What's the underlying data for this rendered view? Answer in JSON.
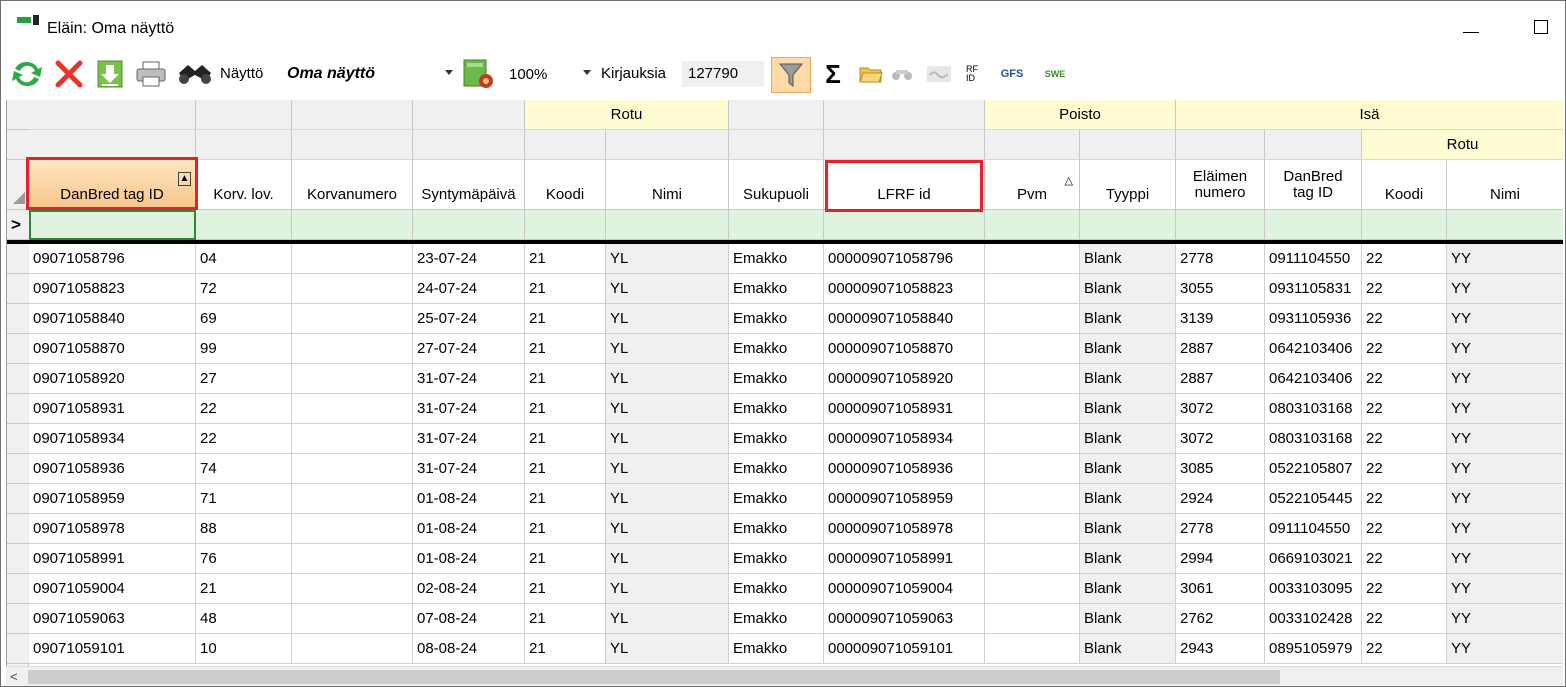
{
  "window": {
    "title": "Eläin: Oma näyttö"
  },
  "toolbar": {
    "icons": [
      "refresh-icon",
      "delete-icon",
      "download-icon",
      "print-icon",
      "binoculars-icon"
    ],
    "view_label": "Näyttö",
    "view_value": "Oma näyttö",
    "zoom_value": "100%",
    "records_label": "Kirjauksia",
    "records_count": "127790",
    "rfid_text": "RF\nID",
    "gfs_text": "GFS",
    "swe_text": "SWE"
  },
  "grid": {
    "group_headers": {
      "rotu": "Rotu",
      "poisto": "Poisto",
      "isa": "Isä",
      "isa_rotu": "Rotu"
    },
    "columns": [
      "DanBred tag ID",
      "Korv. lov.",
      "Korvanumero",
      "Syntymäpäivä",
      "Koodi",
      "Nimi",
      "Sukupuoli",
      "LFRF id",
      "Pvm",
      "Tyyppi",
      "Eläimen numero",
      "DanBred tag ID",
      "Koodi",
      "Nimi"
    ],
    "new_row_marker": ">",
    "rows": [
      [
        "09071058796",
        "04",
        "",
        "23-07-24",
        "21",
        "YL",
        "Emakko",
        "000009071058796",
        "",
        "Blank",
        "2778",
        "0911104550",
        "22",
        "YY"
      ],
      [
        "09071058823",
        "72",
        "",
        "24-07-24",
        "21",
        "YL",
        "Emakko",
        "000009071058823",
        "",
        "Blank",
        "3055",
        "0931105831",
        "22",
        "YY"
      ],
      [
        "09071058840",
        "69",
        "",
        "25-07-24",
        "21",
        "YL",
        "Emakko",
        "000009071058840",
        "",
        "Blank",
        "3139",
        "0931105936",
        "22",
        "YY"
      ],
      [
        "09071058870",
        "99",
        "",
        "27-07-24",
        "21",
        "YL",
        "Emakko",
        "000009071058870",
        "",
        "Blank",
        "2887",
        "0642103406",
        "22",
        "YY"
      ],
      [
        "09071058920",
        "27",
        "",
        "31-07-24",
        "21",
        "YL",
        "Emakko",
        "000009071058920",
        "",
        "Blank",
        "2887",
        "0642103406",
        "22",
        "YY"
      ],
      [
        "09071058931",
        "22",
        "",
        "31-07-24",
        "21",
        "YL",
        "Emakko",
        "000009071058931",
        "",
        "Blank",
        "3072",
        "0803103168",
        "22",
        "YY"
      ],
      [
        "09071058934",
        "22",
        "",
        "31-07-24",
        "21",
        "YL",
        "Emakko",
        "000009071058934",
        "",
        "Blank",
        "3072",
        "0803103168",
        "22",
        "YY"
      ],
      [
        "09071058936",
        "74",
        "",
        "31-07-24",
        "21",
        "YL",
        "Emakko",
        "000009071058936",
        "",
        "Blank",
        "3085",
        "0522105807",
        "22",
        "YY"
      ],
      [
        "09071058959",
        "71",
        "",
        "01-08-24",
        "21",
        "YL",
        "Emakko",
        "000009071058959",
        "",
        "Blank",
        "2924",
        "0522105445",
        "22",
        "YY"
      ],
      [
        "09071058978",
        "88",
        "",
        "01-08-24",
        "21",
        "YL",
        "Emakko",
        "000009071058978",
        "",
        "Blank",
        "2778",
        "0911104550",
        "22",
        "YY"
      ],
      [
        "09071058991",
        "76",
        "",
        "01-08-24",
        "21",
        "YL",
        "Emakko",
        "000009071058991",
        "",
        "Blank",
        "2994",
        "0669103021",
        "22",
        "YY"
      ],
      [
        "09071059004",
        "21",
        "",
        "02-08-24",
        "21",
        "YL",
        "Emakko",
        "000009071059004",
        "",
        "Blank",
        "3061",
        "0033103095",
        "22",
        "YY"
      ],
      [
        "09071059063",
        "48",
        "",
        "07-08-24",
        "21",
        "YL",
        "Emakko",
        "000009071059063",
        "",
        "Blank",
        "2762",
        "0033102428",
        "22",
        "YY"
      ],
      [
        "09071059101",
        "10",
        "",
        "08-08-24",
        "21",
        "YL",
        "Emakko",
        "000009071059101",
        "",
        "Blank",
        "2943",
        "0895105979",
        "22",
        "YY"
      ]
    ]
  },
  "colors": {
    "highlight_border": "#e0242e",
    "group_header_bg": "#fffbd2",
    "new_row_bg": "#dff3df",
    "sorted_header_bg": "#f8c58a",
    "filter_active_bg": "#ffd9a8"
  }
}
